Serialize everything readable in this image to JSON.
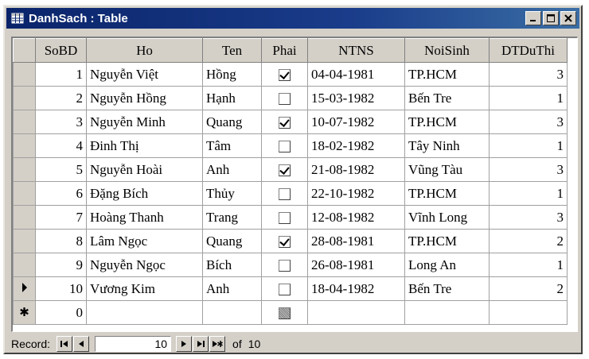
{
  "window": {
    "title": "DanhSach : Table",
    "titlebar_color": "#0a246a"
  },
  "grid": {
    "columns": [
      "SoBD",
      "Ho",
      "Ten",
      "Phai",
      "NTNS",
      "NoiSinh",
      "DTDuThi"
    ],
    "rows": [
      {
        "sobd": "1",
        "ho": "Nguyễn Việt",
        "ten": "Hồng",
        "phai": true,
        "ntns": "04-04-1981",
        "noisinh": "TP.HCM",
        "dtduthi": "3"
      },
      {
        "sobd": "2",
        "ho": "Nguyễn Hồng",
        "ten": "Hạnh",
        "phai": false,
        "ntns": "15-03-1982",
        "noisinh": "Bến Tre",
        "dtduthi": "1"
      },
      {
        "sobd": "3",
        "ho": "Nguyễn Minh",
        "ten": "Quang",
        "phai": true,
        "ntns": "10-07-1982",
        "noisinh": "TP.HCM",
        "dtduthi": "3"
      },
      {
        "sobd": "4",
        "ho": "Đinh Thị",
        "ten": "Tâm",
        "phai": false,
        "ntns": "18-02-1982",
        "noisinh": "Tây Ninh",
        "dtduthi": "1"
      },
      {
        "sobd": "5",
        "ho": "Nguyễn Hoài",
        "ten": "Anh",
        "phai": true,
        "ntns": "21-08-1982",
        "noisinh": "Vũng Tàu",
        "dtduthi": "3"
      },
      {
        "sobd": "6",
        "ho": "Đặng Bích",
        "ten": "Thủy",
        "phai": false,
        "ntns": "22-10-1982",
        "noisinh": "TP.HCM",
        "dtduthi": "1"
      },
      {
        "sobd": "7",
        "ho": "Hoàng Thanh",
        "ten": "Trang",
        "phai": false,
        "ntns": "12-08-1982",
        "noisinh": "Vĩnh Long",
        "dtduthi": "3"
      },
      {
        "sobd": "8",
        "ho": "Lâm Ngọc",
        "ten": "Quang",
        "phai": true,
        "ntns": "28-08-1981",
        "noisinh": "TP.HCM",
        "dtduthi": "2"
      },
      {
        "sobd": "9",
        "ho": "Nguyễn Ngọc",
        "ten": "Bích",
        "phai": false,
        "ntns": "26-08-1981",
        "noisinh": "Long An",
        "dtduthi": "1"
      },
      {
        "sobd": "10",
        "ho": "Vương Kim",
        "ten": "Anh",
        "phai": false,
        "ntns": "18-04-1982",
        "noisinh": "Bến Tre",
        "dtduthi": "2",
        "current": true
      }
    ],
    "new_row": {
      "marker": "✱",
      "sobd": "0"
    }
  },
  "status": {
    "record_label": "Record:",
    "current_record": "10",
    "of_label": "of",
    "total_records": "10",
    "nav_icons": [
      "first-record-icon",
      "prev-record-icon",
      "next-record-icon",
      "last-record-icon",
      "new-record-icon"
    ]
  }
}
